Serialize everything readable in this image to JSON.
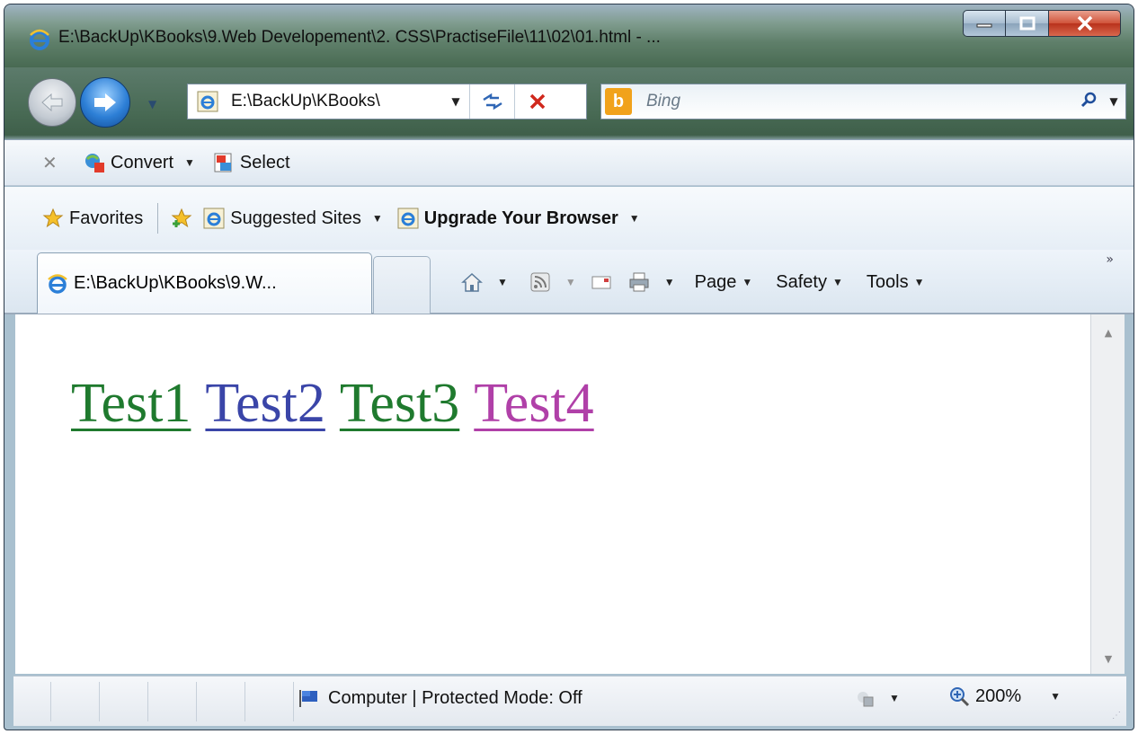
{
  "window": {
    "title": "E:\\BackUp\\KBooks\\9.Web Developement\\2. CSS\\PractiseFile\\11\\02\\01.html - ..."
  },
  "address": {
    "url": "E:\\BackUp\\KBooks\\"
  },
  "search": {
    "placeholder": "Bing"
  },
  "convert_bar": {
    "convert_label": "Convert",
    "select_label": "Select"
  },
  "favorites_bar": {
    "favorites_label": "Favorites",
    "suggested_sites_label": "Suggested Sites",
    "upgrade_label": "Upgrade Your Browser"
  },
  "tab": {
    "title": "E:\\BackUp\\KBooks\\9.W..."
  },
  "command_bar": {
    "page_label": "Page",
    "safety_label": "Safety",
    "tools_label": "Tools",
    "more": "»"
  },
  "content": {
    "links": [
      {
        "text": "Test1",
        "color": "#1f7a2e"
      },
      {
        "text": "Test2",
        "color": "#3a45a8"
      },
      {
        "text": "Test3",
        "color": "#1f7a2e"
      },
      {
        "text": "Test4",
        "color": "#b040a8"
      }
    ]
  },
  "status": {
    "zone_text": "Computer | Protected Mode: Off",
    "zoom": "200%"
  }
}
